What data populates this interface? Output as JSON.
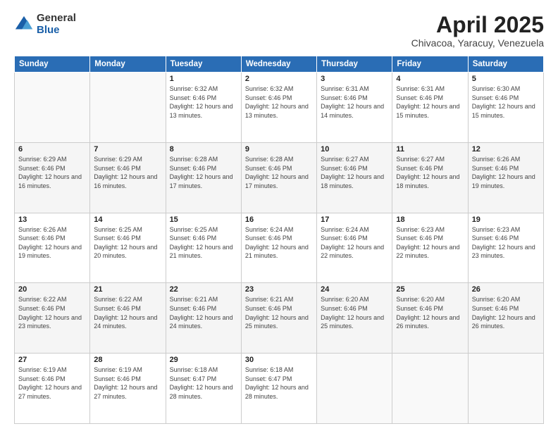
{
  "logo": {
    "general": "General",
    "blue": "Blue"
  },
  "header": {
    "month": "April 2025",
    "location": "Chivacoa, Yaracuy, Venezuela"
  },
  "days_of_week": [
    "Sunday",
    "Monday",
    "Tuesday",
    "Wednesday",
    "Thursday",
    "Friday",
    "Saturday"
  ],
  "weeks": [
    [
      {
        "day": "",
        "info": ""
      },
      {
        "day": "",
        "info": ""
      },
      {
        "day": "1",
        "info": "Sunrise: 6:32 AM\nSunset: 6:46 PM\nDaylight: 12 hours and 13 minutes."
      },
      {
        "day": "2",
        "info": "Sunrise: 6:32 AM\nSunset: 6:46 PM\nDaylight: 12 hours and 13 minutes."
      },
      {
        "day": "3",
        "info": "Sunrise: 6:31 AM\nSunset: 6:46 PM\nDaylight: 12 hours and 14 minutes."
      },
      {
        "day": "4",
        "info": "Sunrise: 6:31 AM\nSunset: 6:46 PM\nDaylight: 12 hours and 15 minutes."
      },
      {
        "day": "5",
        "info": "Sunrise: 6:30 AM\nSunset: 6:46 PM\nDaylight: 12 hours and 15 minutes."
      }
    ],
    [
      {
        "day": "6",
        "info": "Sunrise: 6:29 AM\nSunset: 6:46 PM\nDaylight: 12 hours and 16 minutes."
      },
      {
        "day": "7",
        "info": "Sunrise: 6:29 AM\nSunset: 6:46 PM\nDaylight: 12 hours and 16 minutes."
      },
      {
        "day": "8",
        "info": "Sunrise: 6:28 AM\nSunset: 6:46 PM\nDaylight: 12 hours and 17 minutes."
      },
      {
        "day": "9",
        "info": "Sunrise: 6:28 AM\nSunset: 6:46 PM\nDaylight: 12 hours and 17 minutes."
      },
      {
        "day": "10",
        "info": "Sunrise: 6:27 AM\nSunset: 6:46 PM\nDaylight: 12 hours and 18 minutes."
      },
      {
        "day": "11",
        "info": "Sunrise: 6:27 AM\nSunset: 6:46 PM\nDaylight: 12 hours and 18 minutes."
      },
      {
        "day": "12",
        "info": "Sunrise: 6:26 AM\nSunset: 6:46 PM\nDaylight: 12 hours and 19 minutes."
      }
    ],
    [
      {
        "day": "13",
        "info": "Sunrise: 6:26 AM\nSunset: 6:46 PM\nDaylight: 12 hours and 19 minutes."
      },
      {
        "day": "14",
        "info": "Sunrise: 6:25 AM\nSunset: 6:46 PM\nDaylight: 12 hours and 20 minutes."
      },
      {
        "day": "15",
        "info": "Sunrise: 6:25 AM\nSunset: 6:46 PM\nDaylight: 12 hours and 21 minutes."
      },
      {
        "day": "16",
        "info": "Sunrise: 6:24 AM\nSunset: 6:46 PM\nDaylight: 12 hours and 21 minutes."
      },
      {
        "day": "17",
        "info": "Sunrise: 6:24 AM\nSunset: 6:46 PM\nDaylight: 12 hours and 22 minutes."
      },
      {
        "day": "18",
        "info": "Sunrise: 6:23 AM\nSunset: 6:46 PM\nDaylight: 12 hours and 22 minutes."
      },
      {
        "day": "19",
        "info": "Sunrise: 6:23 AM\nSunset: 6:46 PM\nDaylight: 12 hours and 23 minutes."
      }
    ],
    [
      {
        "day": "20",
        "info": "Sunrise: 6:22 AM\nSunset: 6:46 PM\nDaylight: 12 hours and 23 minutes."
      },
      {
        "day": "21",
        "info": "Sunrise: 6:22 AM\nSunset: 6:46 PM\nDaylight: 12 hours and 24 minutes."
      },
      {
        "day": "22",
        "info": "Sunrise: 6:21 AM\nSunset: 6:46 PM\nDaylight: 12 hours and 24 minutes."
      },
      {
        "day": "23",
        "info": "Sunrise: 6:21 AM\nSunset: 6:46 PM\nDaylight: 12 hours and 25 minutes."
      },
      {
        "day": "24",
        "info": "Sunrise: 6:20 AM\nSunset: 6:46 PM\nDaylight: 12 hours and 25 minutes."
      },
      {
        "day": "25",
        "info": "Sunrise: 6:20 AM\nSunset: 6:46 PM\nDaylight: 12 hours and 26 minutes."
      },
      {
        "day": "26",
        "info": "Sunrise: 6:20 AM\nSunset: 6:46 PM\nDaylight: 12 hours and 26 minutes."
      }
    ],
    [
      {
        "day": "27",
        "info": "Sunrise: 6:19 AM\nSunset: 6:46 PM\nDaylight: 12 hours and 27 minutes."
      },
      {
        "day": "28",
        "info": "Sunrise: 6:19 AM\nSunset: 6:46 PM\nDaylight: 12 hours and 27 minutes."
      },
      {
        "day": "29",
        "info": "Sunrise: 6:18 AM\nSunset: 6:47 PM\nDaylight: 12 hours and 28 minutes."
      },
      {
        "day": "30",
        "info": "Sunrise: 6:18 AM\nSunset: 6:47 PM\nDaylight: 12 hours and 28 minutes."
      },
      {
        "day": "",
        "info": ""
      },
      {
        "day": "",
        "info": ""
      },
      {
        "day": "",
        "info": ""
      }
    ]
  ]
}
